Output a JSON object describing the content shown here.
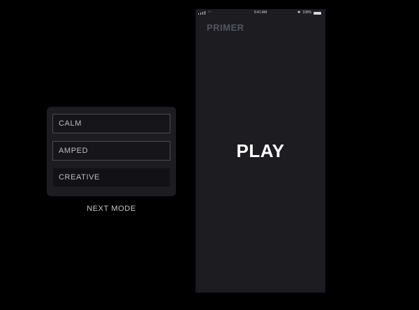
{
  "mode_picker": {
    "options": [
      {
        "label": "CALM"
      },
      {
        "label": "AMPED"
      },
      {
        "label": "CREATIVE"
      }
    ],
    "next_label": "NEXT MODE"
  },
  "phone": {
    "status_bar": {
      "time": "9:41 AM",
      "battery": "100%",
      "signal_icon": "signal-icon",
      "wifi_icon": "wifi-icon",
      "bluetooth_icon": "bluetooth-icon",
      "battery_icon": "battery-icon"
    },
    "app_title": "PRIMER",
    "play_label": "PLAY"
  },
  "colors": {
    "background": "#000000",
    "surface": "#1c1c21",
    "title_muted": "#55555e",
    "text": "#ffffff"
  }
}
